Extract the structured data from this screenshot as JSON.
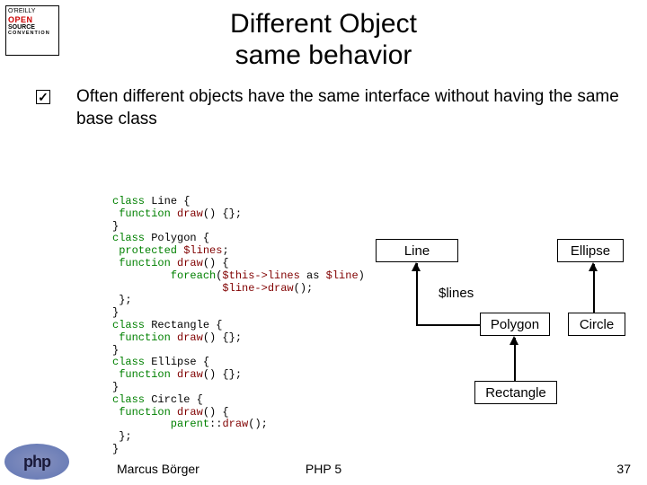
{
  "logo": {
    "line1": "O'REILLY",
    "open": "OPEN",
    "source": "SOURCE",
    "convention": "CONVENTION"
  },
  "title": {
    "line1": "Different Object",
    "line2": "same behavior"
  },
  "bullet": "Often different objects have the same interface without having the same base class",
  "code": {
    "l1a": "class",
    "l1b": " Line {",
    "l2a": " function",
    "l2b": " draw",
    "l2c": "() {};",
    "l3": "}",
    "l4a": "class",
    "l4b": " Polygon {",
    "l5a": " protected",
    "l5b": " $lines",
    "l5c": ";",
    "l6a": " function",
    "l6b": " draw",
    "l6c": "() {",
    "l7a": "         foreach",
    "l7b": "(",
    "l7c": "$this->lines",
    "l7d": " as ",
    "l7e": "$line",
    "l7f": ")",
    "l8a": "                 $line->",
    "l8b": "draw",
    "l8c": "();",
    "l9": " };",
    "l10": "}",
    "l11a": "class",
    "l11b": " Rectangle {",
    "l12a": " function",
    "l12b": " draw",
    "l12c": "() {};",
    "l13": "}",
    "l14a": "class",
    "l14b": " Ellipse {",
    "l15a": " function",
    "l15b": " draw",
    "l15c": "() {};",
    "l16": "}",
    "l17a": "class",
    "l17b": " Circle {",
    "l18a": " function",
    "l18b": " draw",
    "l18c": "() {",
    "l19a": "         parent",
    "l19b": "::",
    "l19c": "draw",
    "l19d": "();",
    "l20": " };",
    "l21": "}"
  },
  "boxes": {
    "line": "Line",
    "ellipse": "Ellipse",
    "polygon": "Polygon",
    "circle": "Circle",
    "rectangle": "Rectangle",
    "lines_label": "$lines"
  },
  "php": "php",
  "footer": {
    "author": "Marcus Börger",
    "center": "PHP 5",
    "page": "37"
  }
}
